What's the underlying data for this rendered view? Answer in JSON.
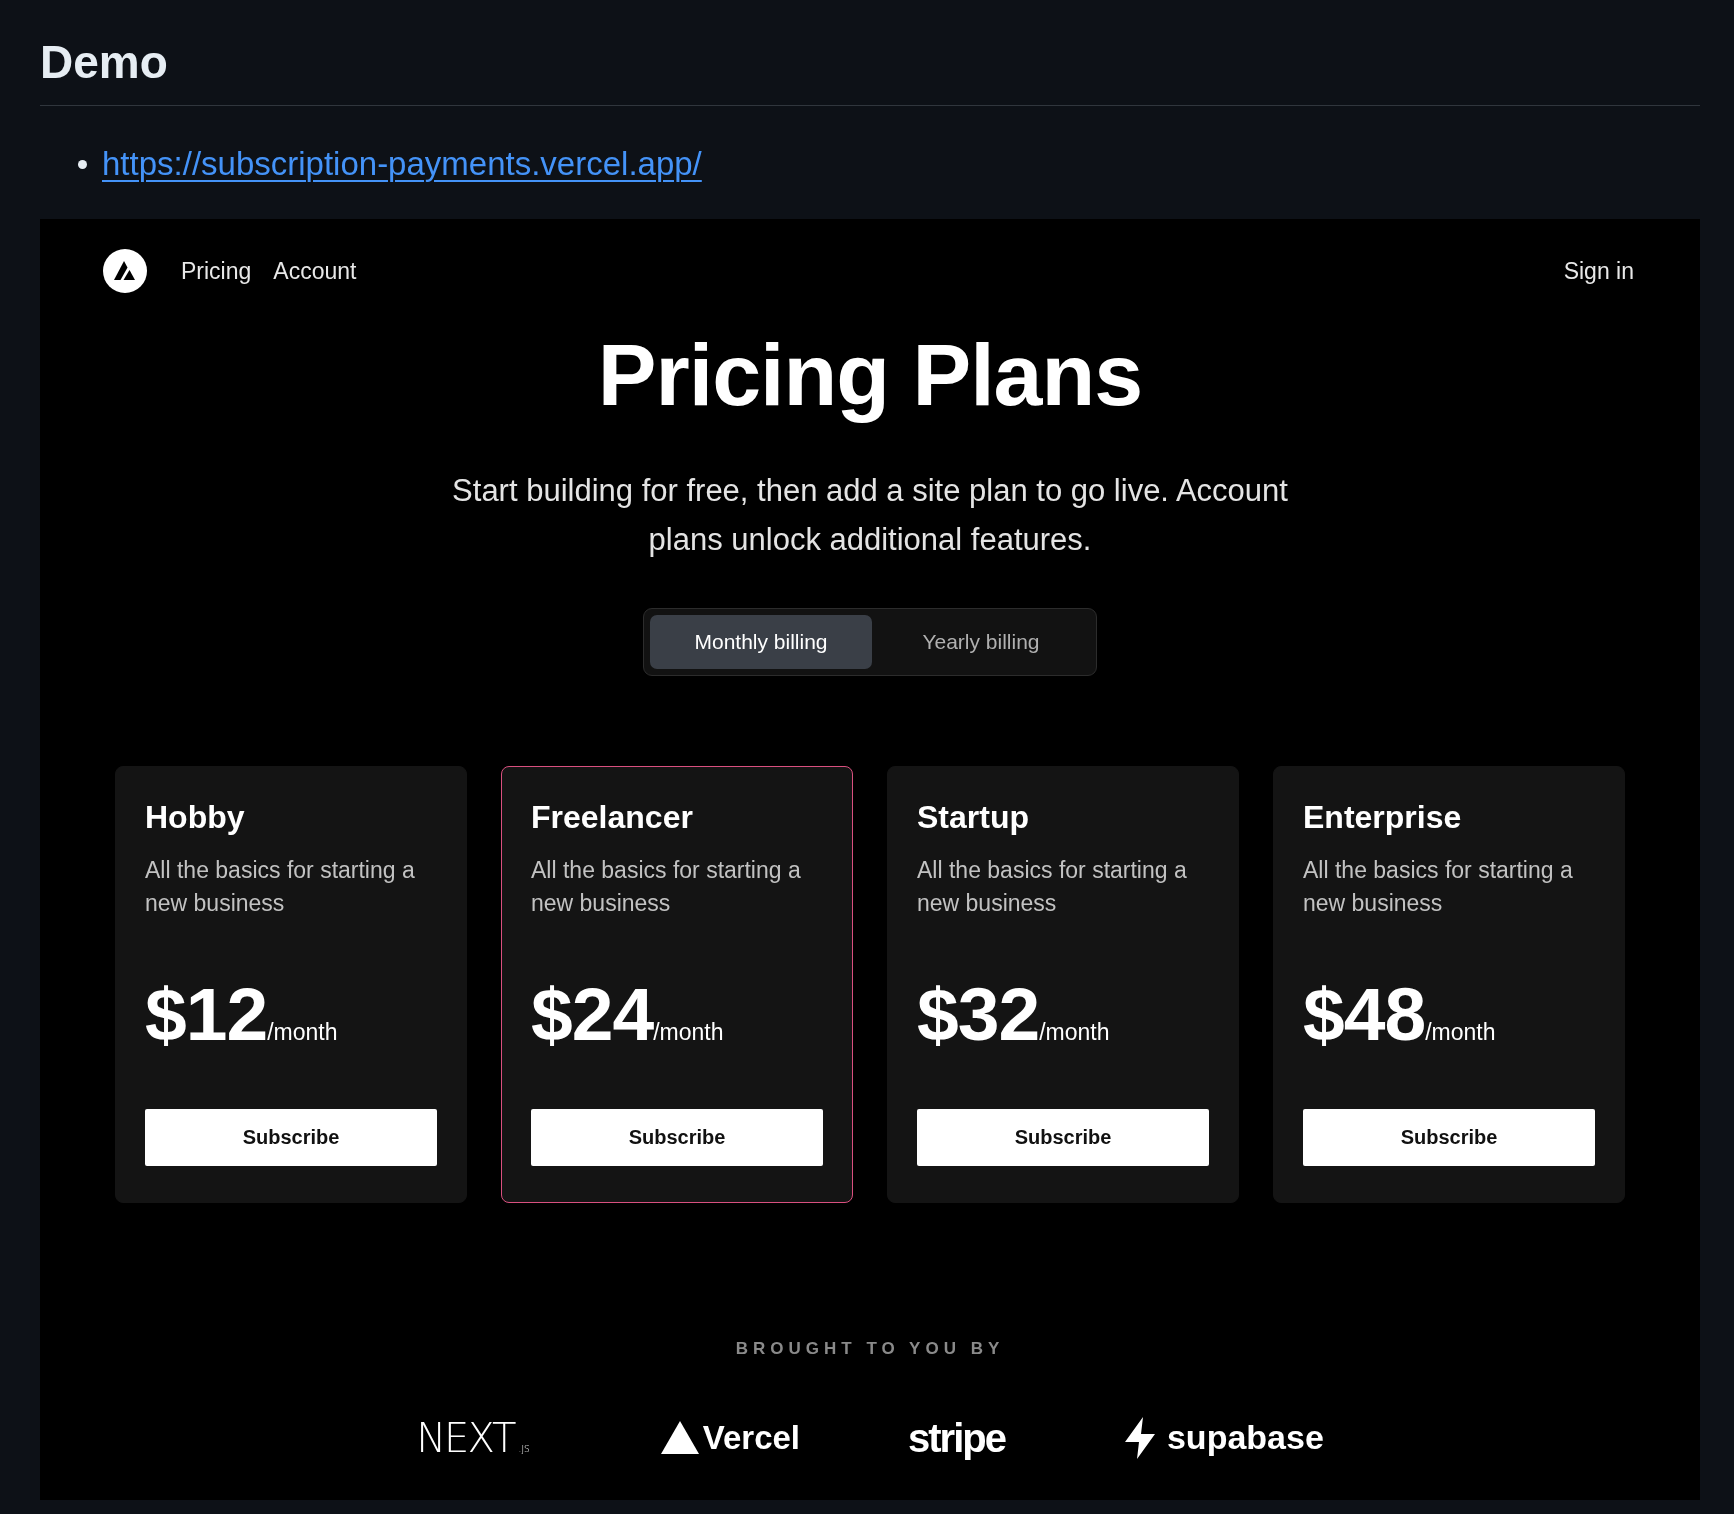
{
  "section": {
    "heading": "Demo",
    "links": [
      "https://subscription-payments.vercel.app/"
    ]
  },
  "app": {
    "nav": {
      "links": [
        {
          "label": "Pricing"
        },
        {
          "label": "Account"
        }
      ],
      "sign_in": "Sign in"
    },
    "title": "Pricing Plans",
    "subtitle": "Start building for free, then add a site plan to go live. Account plans unlock additional features.",
    "billing": [
      {
        "label": "Monthly billing",
        "selected": true
      },
      {
        "label": "Yearly billing",
        "selected": false
      }
    ],
    "plans": [
      {
        "name": "Hobby",
        "description": "All the basics for starting a new business",
        "price": "$12",
        "period": "/month",
        "button": "Subscribe",
        "highlighted": false
      },
      {
        "name": "Freelancer",
        "description": "All the basics for starting a new business",
        "price": "$24",
        "period": "/month",
        "button": "Subscribe",
        "highlighted": true
      },
      {
        "name": "Startup",
        "description": "All the basics for starting a new business",
        "price": "$32",
        "period": "/month",
        "button": "Subscribe",
        "highlighted": false
      },
      {
        "name": "Enterprise",
        "description": "All the basics for starting a new business",
        "price": "$48",
        "period": "/month",
        "button": "Subscribe",
        "highlighted": false
      }
    ],
    "sponsors": {
      "heading": "BROUGHT TO YOU BY",
      "logos": [
        {
          "kind": "nextjs",
          "text": "NEXT$_{.JS}$"
        },
        {
          "kind": "vercel",
          "text": "Vercel"
        },
        {
          "kind": "stripe",
          "text": "stripe"
        },
        {
          "kind": "supabase",
          "text": "supabase"
        }
      ]
    }
  }
}
